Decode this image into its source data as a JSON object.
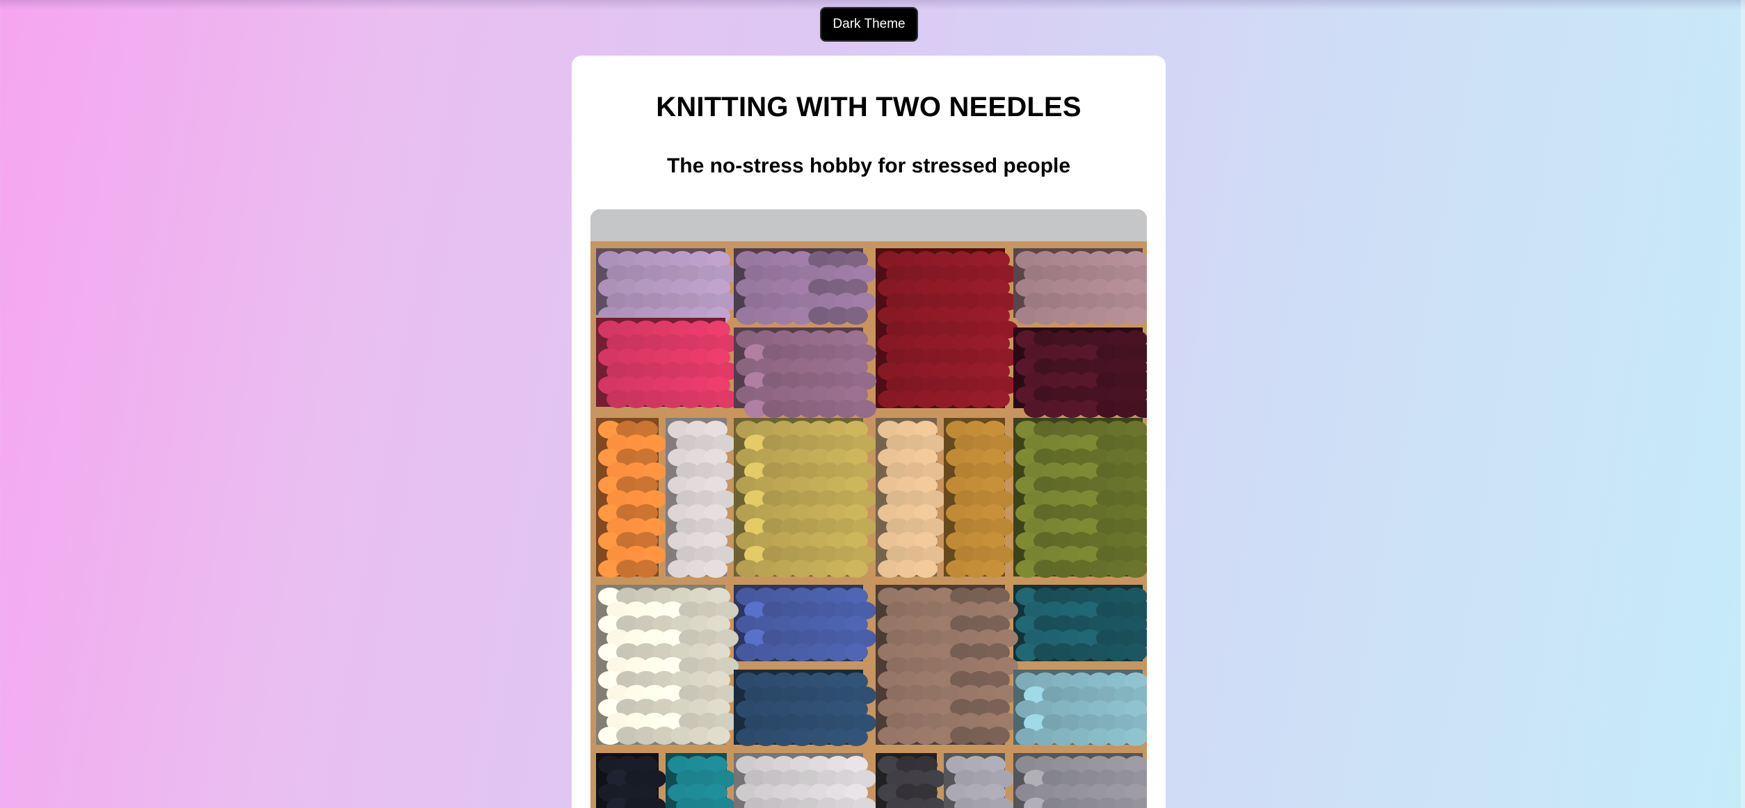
{
  "theme_toggle": {
    "label": "Dark Theme"
  },
  "header": {
    "title": "KNITTING WITH TWO NEEDLES",
    "subtitle": "The no-stress hobby for stressed people"
  },
  "hero_image": {
    "subject": "yarn-shelves-photo",
    "colors": {
      "wall": "#c4c6c8",
      "wood": "#c8955e",
      "cubby_back": "#8a5a2e"
    },
    "cubbies": [
      {
        "c": "#a98fb4"
      },
      {
        "c": "#8d6f93"
      },
      {
        "c": "#8d1a26"
      },
      {
        "c": "#a27f87"
      },
      {
        "c": "#d0365f"
      },
      {
        "c": "#9a6f8e"
      },
      {
        "c": "#a8322a"
      },
      {
        "c": "#4d1426"
      },
      {
        "c": "#e8853a"
      },
      {
        "c": "#ece4e4"
      },
      {
        "c": "#c9b25a"
      },
      {
        "c": "#d8b48a"
      },
      {
        "c": "#b98535"
      },
      {
        "c": "#6f7a2e"
      },
      {
        "c": "#3e8ea0"
      },
      {
        "c": "#e9e6d4"
      },
      {
        "c": "#5f8a3c"
      },
      {
        "c": "#4e63b0"
      },
      {
        "c": "#8a6d5f"
      },
      {
        "c": "#1d5a66"
      },
      {
        "c": "#8cbfcc"
      },
      {
        "c": "#2e4e70"
      },
      {
        "c": "#1b1f2b"
      },
      {
        "c": "#1e8a95"
      },
      {
        "c": "#d7d3d6"
      },
      {
        "c": "#3c3a40"
      },
      {
        "c": "#9b9aa3"
      }
    ]
  }
}
